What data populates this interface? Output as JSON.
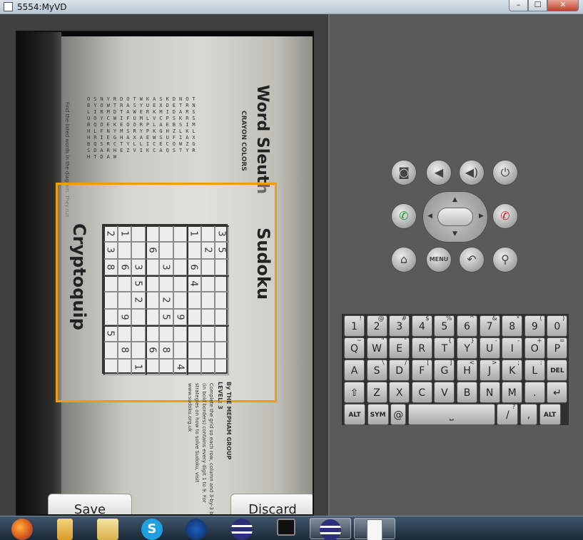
{
  "window": {
    "title": "5554:MyVD",
    "min_label": "–",
    "max_label": "☐",
    "close_label": "✕"
  },
  "photo": {
    "word_sleuth_title": "Word Sleuth",
    "word_sleuth_subtitle": "CRAYON COLORS",
    "sudoku_title": "Sudoku",
    "crypto_title": "Cryptoquip",
    "byline": "By THE MEPHAM GROUP",
    "level": "LEVEL: 3",
    "instructions": "Complete the grid so each row, column and 3-by-3 box (in bold borders) contains every digit 1 to 9. For strategies on how to solve Sudoku, visit www.sudoku.org.uk",
    "find_words": "Find the listed words in the diagram. They run",
    "letters": "OSNYRDOTWKASKDNOTBYOWTRASYUEXDETRNLIRMDTAWERKMIDARSUOYCWIFUMLVCPSKRSBQOEKEOORPLAEBSIMHLFNYMSRYPKGHZLKLHRIEGHAXAEWSUFIAXBQSRCTYLLICECOWZGSDARHEZVIKCAQSTYRHTDAW",
    "sudoku_cells": [
      {
        "r": 0,
        "c": 0,
        "v": "3"
      },
      {
        "r": 0,
        "c": 1,
        "v": "5"
      },
      {
        "r": 1,
        "c": 1,
        "v": "2"
      },
      {
        "r": 2,
        "c": 0,
        "v": "1"
      },
      {
        "r": 2,
        "c": 2,
        "v": "6"
      },
      {
        "r": 2,
        "c": 3,
        "v": "4"
      },
      {
        "r": 3,
        "c": 5,
        "v": "9"
      },
      {
        "r": 4,
        "c": 2,
        "v": "3"
      },
      {
        "r": 4,
        "c": 4,
        "v": "2"
      },
      {
        "r": 4,
        "c": 5,
        "v": "5"
      },
      {
        "r": 5,
        "c": 1,
        "v": "6"
      },
      {
        "r": 6,
        "c": 2,
        "v": "3"
      },
      {
        "r": 6,
        "c": 3,
        "v": "5"
      },
      {
        "r": 6,
        "c": 4,
        "v": "2"
      },
      {
        "r": 7,
        "c": 0,
        "v": "1"
      },
      {
        "r": 7,
        "c": 2,
        "v": "6"
      },
      {
        "r": 7,
        "c": 5,
        "v": "9"
      },
      {
        "r": 7,
        "c": 7,
        "v": "8"
      },
      {
        "r": 8,
        "c": 0,
        "v": "2"
      },
      {
        "r": 8,
        "c": 1,
        "v": "3"
      },
      {
        "r": 8,
        "c": 2,
        "v": "8"
      },
      {
        "r": 8,
        "c": 6,
        "v": "5"
      },
      {
        "r": 6,
        "c": 8,
        "v": "1"
      },
      {
        "r": 5,
        "c": 7,
        "v": "6"
      },
      {
        "r": 4,
        "c": 7,
        "v": "8"
      },
      {
        "r": 3,
        "c": 8,
        "v": "4"
      }
    ]
  },
  "buttons": {
    "save": "Save",
    "discard": "Discard"
  },
  "controls": {
    "menu_label": "MENU",
    "icons": [
      "camera-icon",
      "volume-down-icon",
      "volume-up-icon",
      "power-icon",
      "call-icon",
      "end-call-icon",
      "home-icon",
      "back-icon",
      "search-icon"
    ]
  },
  "keyboard": {
    "rows": [
      [
        [
          "1",
          "!"
        ],
        [
          "2",
          "@"
        ],
        [
          "3",
          "#"
        ],
        [
          "4",
          "$"
        ],
        [
          "5",
          "%"
        ],
        [
          "6",
          "^"
        ],
        [
          "7",
          "&"
        ],
        [
          "8",
          "*"
        ],
        [
          "9",
          "("
        ],
        [
          "0",
          ")"
        ]
      ],
      [
        [
          "Q",
          "~"
        ],
        [
          "W",
          "\""
        ],
        [
          "E",
          "\""
        ],
        [
          "R",
          "`"
        ],
        [
          "T",
          "{"
        ],
        [
          "Y",
          "}"
        ],
        [
          "U",
          "-"
        ],
        [
          "I",
          "-"
        ],
        [
          "O",
          "+"
        ],
        [
          "P",
          "="
        ]
      ],
      [
        [
          "A",
          ""
        ],
        [
          "S",
          "\\"
        ],
        [
          "D",
          "/"
        ],
        [
          "F",
          "["
        ],
        [
          "G",
          "]"
        ],
        [
          "H",
          "<"
        ],
        [
          "J",
          ">"
        ],
        [
          "K",
          ";"
        ],
        [
          "L",
          ":"
        ],
        [
          "DEL",
          ""
        ]
      ],
      [
        [
          "⇧",
          ""
        ],
        [
          "Z",
          ""
        ],
        [
          "X",
          ""
        ],
        [
          "C",
          ""
        ],
        [
          "V",
          ""
        ],
        [
          "B",
          ""
        ],
        [
          "N",
          ""
        ],
        [
          "M",
          ""
        ],
        [
          ".",
          ""
        ],
        [
          "↵",
          ""
        ]
      ],
      [
        [
          "ALT",
          ""
        ],
        [
          "SYM",
          ""
        ],
        [
          "@",
          ""
        ],
        [
          "⎵",
          ""
        ],
        [
          "/",
          "?"
        ],
        [
          ",",
          ""
        ],
        [
          "ALT",
          ""
        ]
      ]
    ]
  },
  "taskbar": {
    "items": [
      "firefox-icon",
      "folder-icon",
      "explorer-icon",
      "skype-icon",
      "network-icon",
      "eclipse-icon",
      "terminal-icon",
      "eclipse-icon-2",
      "notepad-icon"
    ]
  }
}
